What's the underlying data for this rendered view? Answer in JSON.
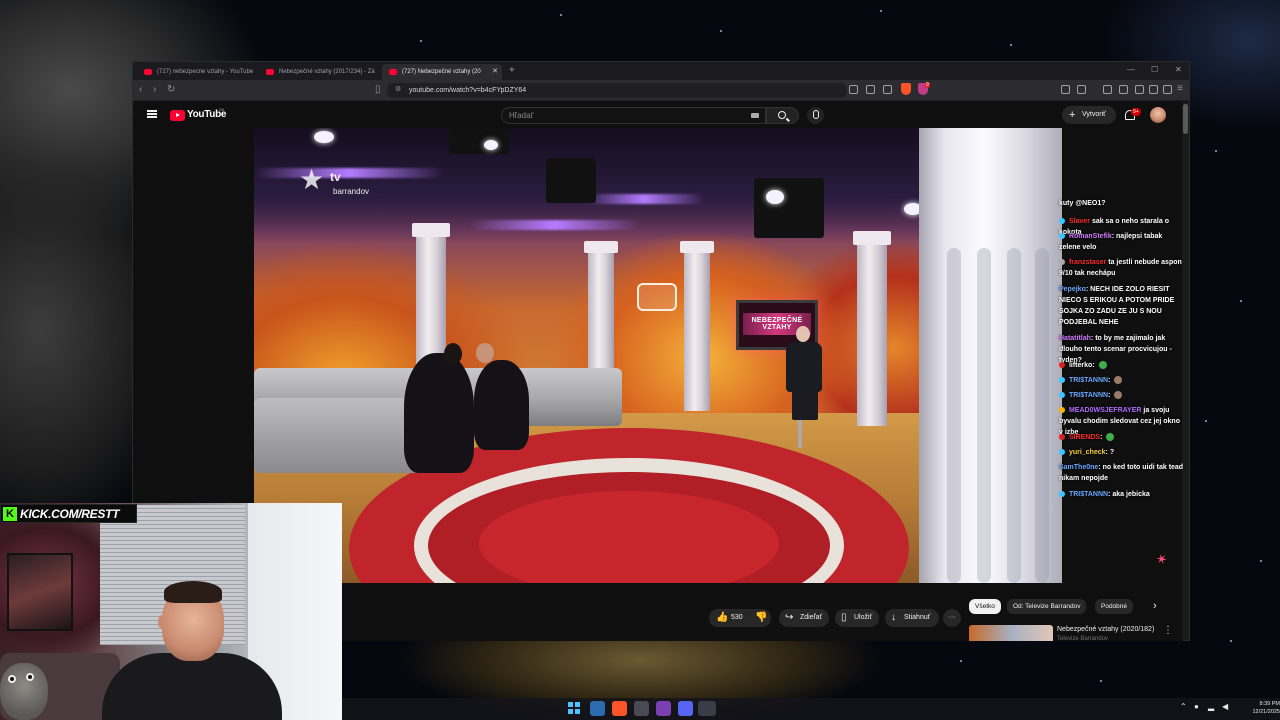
{
  "browser": {
    "tabs": [
      {
        "label": "(727) nebezpecne vztahy - YouTube",
        "active": false
      },
      {
        "label": "Nebezpečné vztahy (2017/234) - Zá",
        "active": false
      },
      {
        "label": "(727) Nebezpečné vztahy (20",
        "active": true
      }
    ],
    "new_tab": "+",
    "url": "youtube.com/watch?v=b4cFYpDZY64",
    "brave_badge": "9"
  },
  "youtube": {
    "logo": "YouTube",
    "region": "SK",
    "search_placeholder": "Hľadať",
    "create_label": "Vytvoriť",
    "notifications": "9+"
  },
  "video": {
    "channel_watermark_tv": "tv",
    "channel_watermark_name": "barrandov",
    "set_monitor_text": "NEBEZPEČNÉ VZTAHY"
  },
  "chat": [
    {
      "user": "",
      "text": "kuty @NEO1?"
    },
    {
      "user": "Slaver",
      "text": "sak sa o neho starala o kokota",
      "color": "#ff2a2a"
    },
    {
      "user": "RomanStefik",
      "text": "najlepsi tabak zelene velo",
      "color": "#d27bff"
    },
    {
      "user": "franzstaser",
      "text": "ta jestli nebude aspon 9/10 tak nechápu",
      "color": "#ff2a2a"
    },
    {
      "user": "Pepejko",
      "text": "NECH IDE ZOLO RIESIT NIECO S ERIKOU A POTOM PRIDE SOJKA ZO ZADU ZE JU S NOU PODJEBAL NEHE",
      "color": "#6aa8ff"
    },
    {
      "user": "Hatatitlah",
      "text": "to by me zajimalo jak dlouho tento scenar procvicujou - tyden?",
      "color": "#d27bff"
    },
    {
      "user": "lifterko",
      "text": "",
      "color": "#ffffff"
    },
    {
      "user": "TRI$TANNN",
      "text": "",
      "color": "#6aa8ff"
    },
    {
      "user": "TRI$TANNN",
      "text": "",
      "color": "#6aa8ff"
    },
    {
      "user": "MEAD0WSJEFRAYER",
      "text": "ja svoju byvalu chodim sledovat cez jej okno v izbe",
      "color": "#b06cff"
    },
    {
      "user": "SIRENDS",
      "text": "",
      "color": "#ff2a2a"
    },
    {
      "user": "yuri_check",
      "text": "?",
      "color": "#f4d03f"
    },
    {
      "user": "SamThe0ne",
      "text": "no ked toto uidi tak tead nikam nepojde",
      "color": "#6aa8ff"
    },
    {
      "user": "TRI$TANNN",
      "text": "aka jebicka",
      "color": "#6aa8ff"
    }
  ],
  "actions": {
    "likes": "530",
    "share": "Zdieľať",
    "save": "Uložiť",
    "download": "Stiahnuť",
    "more": "···"
  },
  "chips": [
    "Všetko",
    "Od: Televize Barrandov",
    "Podobné"
  ],
  "recommended": {
    "title": "Nebezpečné vztahy (2020/182)",
    "channel": "Televize Barrandov"
  },
  "stream_overlay": {
    "kick_url": "KICK.COM/RESTT"
  },
  "taskbar": {
    "time": "8:39 PM",
    "date": "12/21/2025"
  }
}
